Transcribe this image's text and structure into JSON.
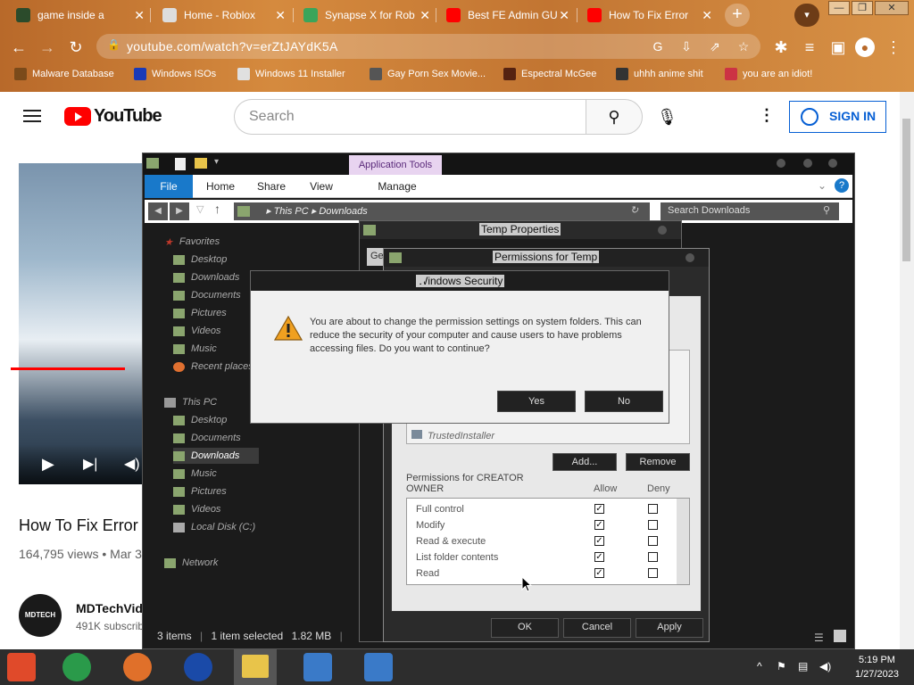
{
  "tabs": [
    {
      "label": "game inside a",
      "color": "#2b4b2b"
    },
    {
      "label": "Home - Roblox",
      "color": "#dddddd"
    },
    {
      "label": "Synapse X for Rob",
      "color": "#3aa55a"
    },
    {
      "label": "Best FE Admin GU",
      "color": "#ff0000"
    },
    {
      "label": "How To Fix Error",
      "color": "#ff0000"
    }
  ],
  "address": {
    "url": "youtube.com/watch?v=erZtJAYdK5A"
  },
  "bookmarks": [
    {
      "label": "Malware Database",
      "color": "#7a4a1a"
    },
    {
      "label": "Windows ISOs",
      "color": "#1a3ab8"
    },
    {
      "label": "Windows 11 Installer",
      "color": "#e0e0e0"
    },
    {
      "label": "Gay Porn Sex Movie...",
      "color": "#555555"
    },
    {
      "label": "Espectral McGee",
      "color": "#552211"
    },
    {
      "label": "uhhh anime shit",
      "color": "#333333"
    },
    {
      "label": "you are an idiot!",
      "color": "#cc3344"
    }
  ],
  "youtube": {
    "logo": "YouTube",
    "search_placeholder": "Search",
    "sign_in": "SIGN IN",
    "video_title": "How To Fix Error",
    "views": "164,795 views • Mar 3",
    "channel": "MDTechVid",
    "channel_avatar": "MDTECH",
    "subs": "491K subscrib"
  },
  "explorer": {
    "app_tools": "Application Tools",
    "ribbon_tabs": [
      "File",
      "Home",
      "Share",
      "View",
      "Manage"
    ],
    "path": [
      "This PC",
      "Downloads"
    ],
    "search_placeholder": "Search Downloads",
    "favorites_header": "Favorites",
    "favorites": [
      "Desktop",
      "Downloads",
      "Documents",
      "Pictures",
      "Videos",
      "Music",
      "Recent places"
    ],
    "thispc_header": "This PC",
    "thispc": [
      "Desktop",
      "Documents",
      "Downloads",
      "Music",
      "Pictures",
      "Videos",
      "Local Disk (C:)"
    ],
    "network": "Network",
    "status": {
      "items": "3 items",
      "selected": "1 item selected",
      "size": "1.82 MB"
    }
  },
  "temp_properties": {
    "title": "Temp Properties",
    "tab_fragment": "Ge"
  },
  "permissions": {
    "title": "Permissions for Temp",
    "trusted": "TrustedInstaller",
    "add": "Add...",
    "remove": "Remove",
    "perm_label": "Permissions for CREATOR OWNER",
    "allow": "Allow",
    "deny": "Deny",
    "rows": [
      {
        "name": "Full control",
        "allow": "✓",
        "deny": ""
      },
      {
        "name": "Modify",
        "allow": "✓",
        "deny": ""
      },
      {
        "name": "Read & execute",
        "allow": "✓",
        "deny": ""
      },
      {
        "name": "List folder contents",
        "allow": "✓",
        "deny": ""
      },
      {
        "name": "Read",
        "allow": "✓",
        "deny": ""
      }
    ],
    "ok": "OK",
    "cancel": "Cancel",
    "apply": "Apply"
  },
  "security": {
    "title": "Windows Security",
    "message": "You are about to change the permission settings on system folders. This can reduce the security of your computer and cause users to have problems accessing files. Do you want to continue?",
    "yes": "Yes",
    "no": "No"
  },
  "taskbar": {
    "time": "5:19 PM",
    "date": "1/27/2023",
    "icons": [
      {
        "name": "app-generic",
        "color": "#e04a2a"
      },
      {
        "name": "chrome",
        "color": "#2a9a4a"
      },
      {
        "name": "firefox",
        "color": "#e0702a"
      },
      {
        "name": "obama",
        "color": "#1a4aa8"
      },
      {
        "name": "file-explorer",
        "color": "#e8c44a"
      },
      {
        "name": "setup-1",
        "color": "#3a7ac8"
      },
      {
        "name": "setup-2",
        "color": "#3a7ac8"
      }
    ]
  }
}
